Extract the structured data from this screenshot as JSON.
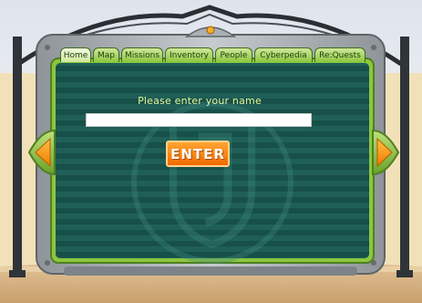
{
  "tabs": [
    {
      "label": "Home",
      "active": true
    },
    {
      "label": "Map",
      "active": false
    },
    {
      "label": "Missions",
      "active": false
    },
    {
      "label": "Inventory",
      "active": false
    },
    {
      "label": "People",
      "active": false
    },
    {
      "label": "Cyberpedia",
      "active": false
    },
    {
      "label": "Re:Quests",
      "active": false
    }
  ],
  "login": {
    "prompt": "Please enter your name",
    "name_value": "",
    "enter_label": "ENTER"
  },
  "nav": {
    "left_arrow": "arrow-left-icon",
    "right_arrow": "arrow-right-icon"
  },
  "colors": {
    "panel": "#1d5a52",
    "tab_green": "#8cc63f",
    "button_orange": "#f28a0f",
    "prompt_text": "#e3f59b"
  }
}
